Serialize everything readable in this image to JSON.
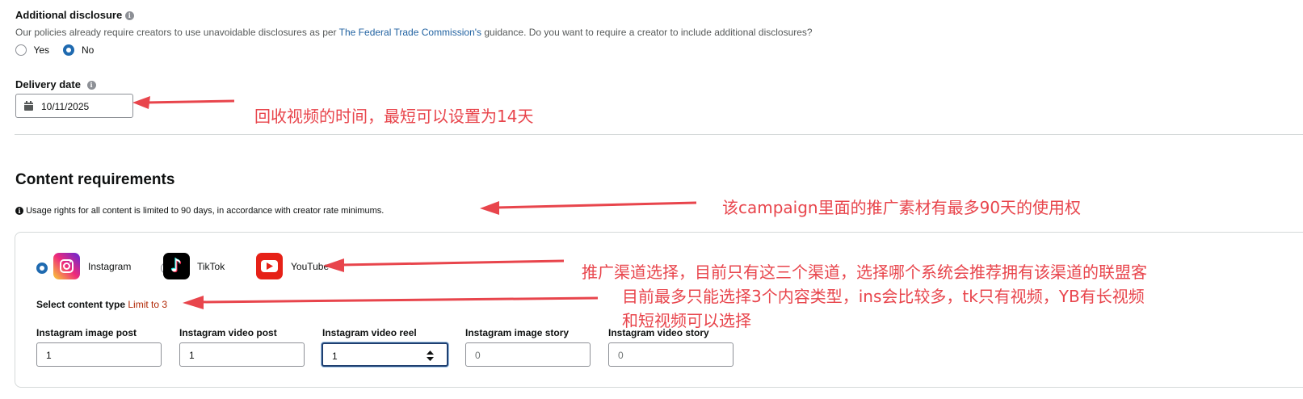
{
  "additional_disclosure": {
    "title": "Additional disclosure",
    "description_prefix": "Our policies already require creators to use unavoidable disclosures as per ",
    "description_link": "The Federal Trade Commission's",
    "description_suffix": " guidance. Do you want to require a creator to include additional disclosures?",
    "options": [
      {
        "label": "Yes",
        "selected": false
      },
      {
        "label": "No",
        "selected": true
      }
    ]
  },
  "delivery_date": {
    "label": "Delivery date",
    "value": "10/11/2025"
  },
  "content_requirements": {
    "heading": "Content requirements",
    "usage_note": "Usage rights for all content is limited to 90 days, in accordance with creator rate minimums."
  },
  "platforms": [
    {
      "label": "Instagram",
      "selected": true,
      "icon": "instagram-icon"
    },
    {
      "label": "TikTok",
      "selected": false,
      "icon": "tiktok-icon"
    },
    {
      "label": "YouTube",
      "selected": false,
      "icon": "youtube-icon"
    }
  ],
  "content_type": {
    "label": "Select content type",
    "limit": "Limit to 3",
    "fields": [
      {
        "label": "Instagram image post",
        "value": "1"
      },
      {
        "label": "Instagram video post",
        "value": "1"
      },
      {
        "label": "Instagram video reel",
        "value": "1"
      },
      {
        "label": "Instagram image story",
        "value": "0"
      },
      {
        "label": "Instagram video story",
        "value": "0"
      }
    ]
  },
  "annotations": {
    "delivery": "回收视频的时间，最短可以设置为14天",
    "usage": "该campaign里面的推广素材有最多90天的使用权",
    "channel": "推广渠道选择，目前只有这三个渠道，选择哪个系统会推荐拥有该渠道的联盟客",
    "content_line1": "目前最多只能选择3个内容类型，ins会比较多，tk只有视频，YB有长视频",
    "content_line2": "和短视频可以选择"
  },
  "colors": {
    "annotation": "#e8454c",
    "accent": "#1f6ab0",
    "link": "#2162a1",
    "limit": "#b12704"
  }
}
